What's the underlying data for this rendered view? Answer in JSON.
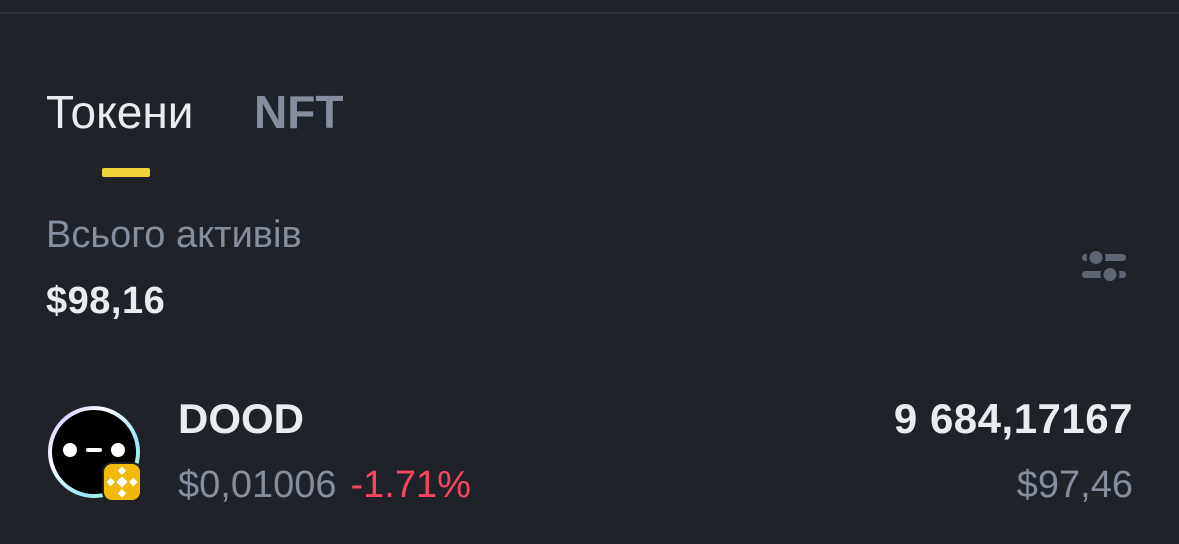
{
  "tabs": [
    {
      "label": "Токени",
      "active": true
    },
    {
      "label": "NFT",
      "active": false
    }
  ],
  "summary": {
    "label": "Всього активів",
    "value": "$98,16"
  },
  "filter": {
    "icon": "sliders-icon"
  },
  "assets": [
    {
      "symbol": "DOOD",
      "price": "$0,01006",
      "change": "-1.71%",
      "amount": "9 684,17167",
      "value": "$97,46",
      "icon": "dood-token-icon",
      "chain_icon": "bnb-chain-icon"
    }
  ],
  "colors": {
    "background": "#1f2229",
    "text_primary": "#eaecef",
    "text_secondary": "#848e9c",
    "accent": "#f0d43a",
    "negative": "#f6465d",
    "bnb": "#f0b90b"
  }
}
